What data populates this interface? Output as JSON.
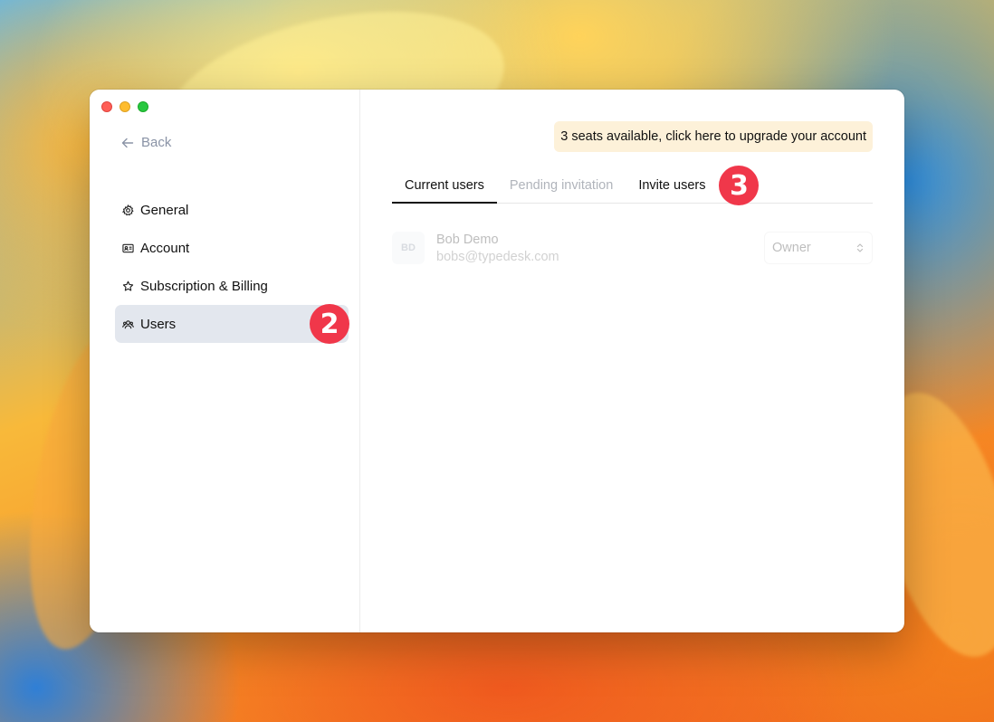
{
  "window": {
    "controls": [
      "close",
      "minimize",
      "zoom"
    ]
  },
  "sidebar": {
    "back_label": "Back",
    "items": [
      {
        "label": "General",
        "icon": "gear-icon"
      },
      {
        "label": "Account",
        "icon": "id-card-icon"
      },
      {
        "label": "Subscription & Billing",
        "icon": "star-icon"
      },
      {
        "label": "Users",
        "icon": "users-icon",
        "active": true
      }
    ],
    "step_badge": "2"
  },
  "main": {
    "upgrade_banner": "3 seats available, click here to upgrade your account",
    "tabs": [
      {
        "label": "Current users",
        "active": true
      },
      {
        "label": "Pending invitation",
        "active": false
      },
      {
        "label": "Invite users",
        "active": false
      }
    ],
    "step_badge": "3",
    "users": [
      {
        "initials": "BD",
        "name": "Bob Demo",
        "email": "bobs@typedesk.com",
        "role": "Owner"
      }
    ]
  },
  "colors": {
    "badge": "#f0374a",
    "active_nav": "#e3e7ee",
    "upgrade_banner_bg": "#fdf1d9"
  }
}
